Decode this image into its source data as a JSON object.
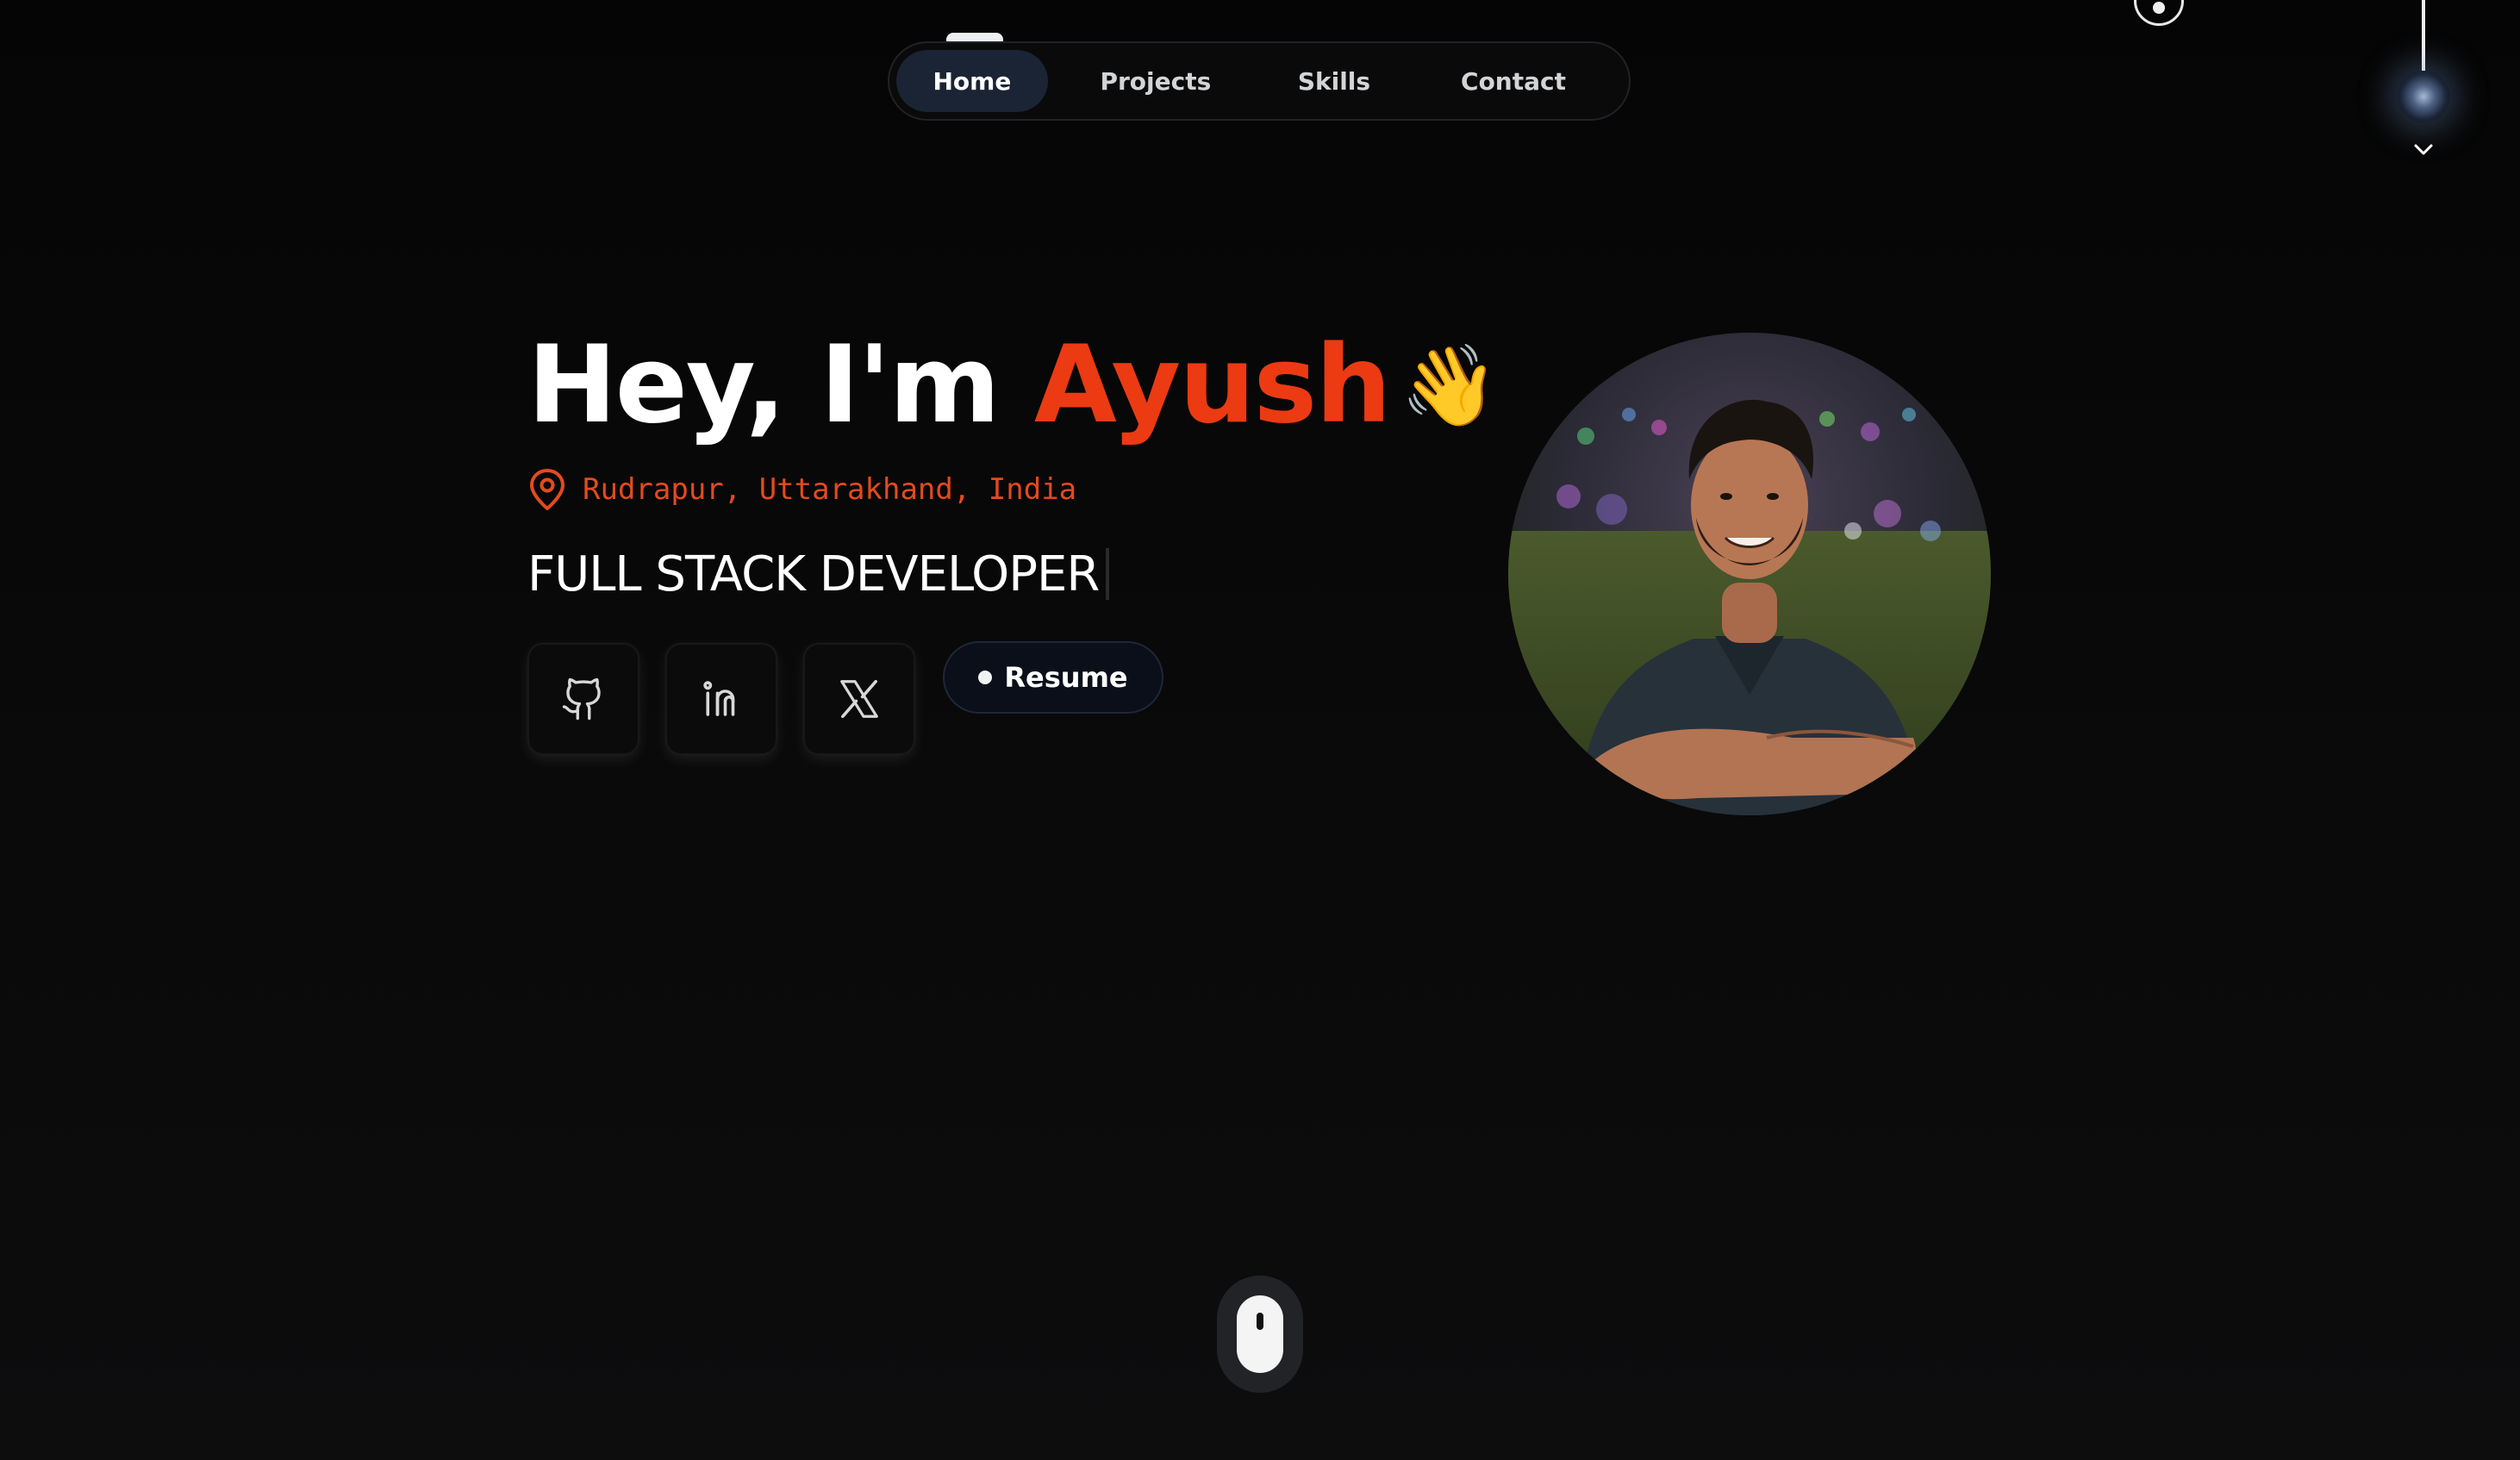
{
  "nav": {
    "items": [
      {
        "label": "Home",
        "active": true
      },
      {
        "label": "Projects",
        "active": false
      },
      {
        "label": "Skills",
        "active": false
      },
      {
        "label": "Contact",
        "active": false
      }
    ]
  },
  "hero": {
    "greeting": "Hey, I'm",
    "name": "Ayush",
    "wave_emoji": "👋",
    "location": "Rudrapur, Uttarakhand, India",
    "role": "FULL STACK DEVELOPER"
  },
  "social": {
    "github_icon": "github-icon",
    "linkedin_icon": "linkedin-icon",
    "x_icon": "x-icon"
  },
  "resume": {
    "label": "Resume"
  },
  "icons": {
    "location": "map-pin-icon",
    "theme_toggle": "lamp-bulb-icon",
    "chevron": "chevron-down-icon",
    "scroll": "mouse-scroll-icon"
  },
  "colors": {
    "background": "#070707",
    "accent": "#ec3a12",
    "nav_active": "#1b2434",
    "text": "#ffffff"
  }
}
